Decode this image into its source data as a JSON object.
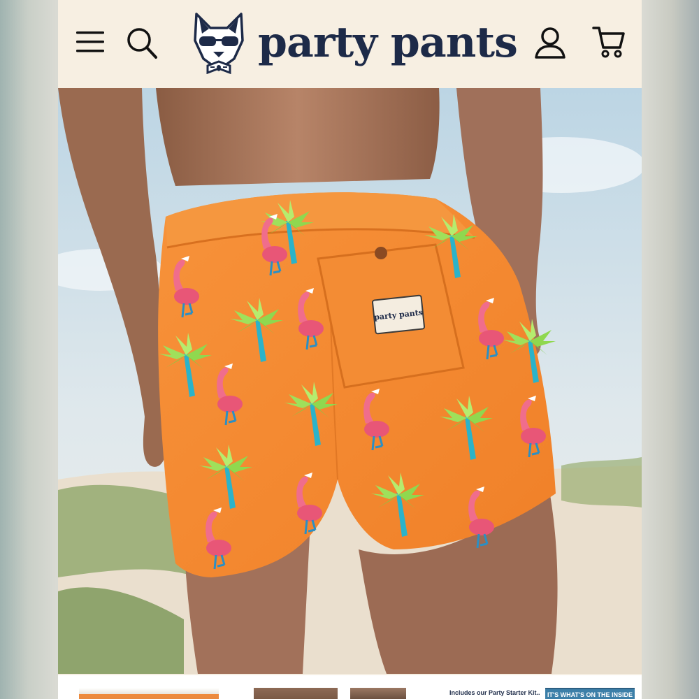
{
  "header": {
    "brand": "party pants",
    "icons": {
      "menu": "hamburger-menu-icon",
      "search": "search-icon",
      "account": "account-icon",
      "cart": "cart-icon"
    }
  },
  "hero": {
    "patch_text": "party pants"
  },
  "thumbnails": [
    {
      "text": ""
    },
    {
      "text": ""
    },
    {
      "text": ""
    },
    {
      "text": "Includes our Party Starter Kit..."
    },
    {
      "text": "IT'S WHAT'S ON THE INSIDE"
    }
  ],
  "colors": {
    "header_bg": "#f7efe2",
    "brand_navy": "#1d2a48",
    "shorts_orange": "#f48a2f"
  }
}
